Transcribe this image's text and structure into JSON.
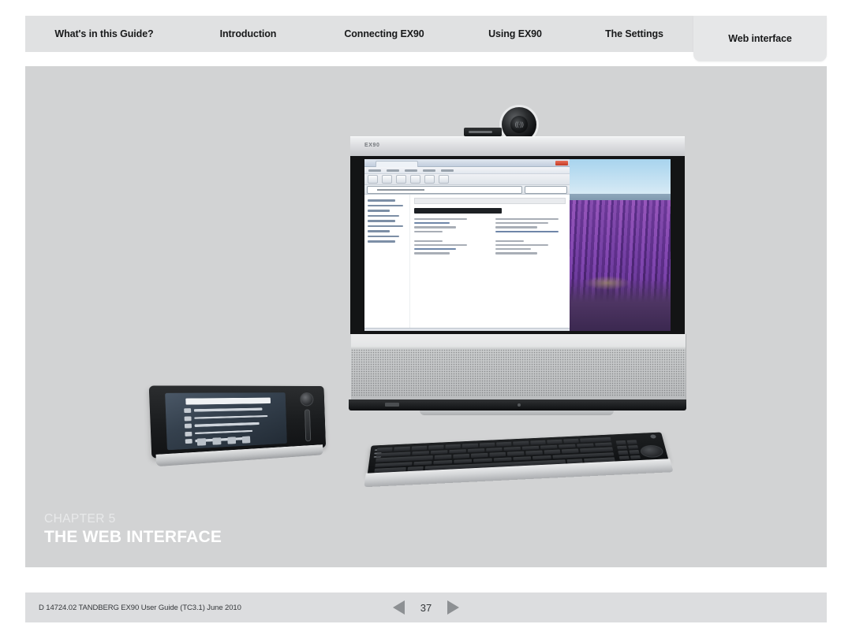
{
  "nav_tabs": [
    {
      "label": "What's in this Guide?",
      "active": false
    },
    {
      "label": "Introduction",
      "active": false
    },
    {
      "label": "Connecting EX90",
      "active": false
    },
    {
      "label": "Using EX90",
      "active": false
    },
    {
      "label": "The Settings",
      "active": false
    },
    {
      "label": "Web interface",
      "active": true
    }
  ],
  "chapter": {
    "kicker": "CHAPTER 5",
    "title": "THE WEB INTERFACE"
  },
  "hero_photo": {
    "product_label": "EX90",
    "devices": [
      "ex90-display-unit",
      "touch-control-panel",
      "wireless-keyboard"
    ],
    "screen_content": "web-browser-over-lavender-field-wallpaper"
  },
  "footer": {
    "document_id": "D 14724.02 TANDBERG EX90 User Guide (TC3.1) June 2010",
    "page_number": "37",
    "prev_label": "◀",
    "next_label": "▶"
  },
  "colors": {
    "tabbar_bg": "#e0e1e2",
    "active_tab_bg": "#e6e7e8",
    "content_bg": "#d2d3d4",
    "footer_bg": "#dcdddf",
    "text_dark": "#18191a",
    "chapter_title": "#ffffff",
    "pager_arrow": "#8d9093"
  }
}
